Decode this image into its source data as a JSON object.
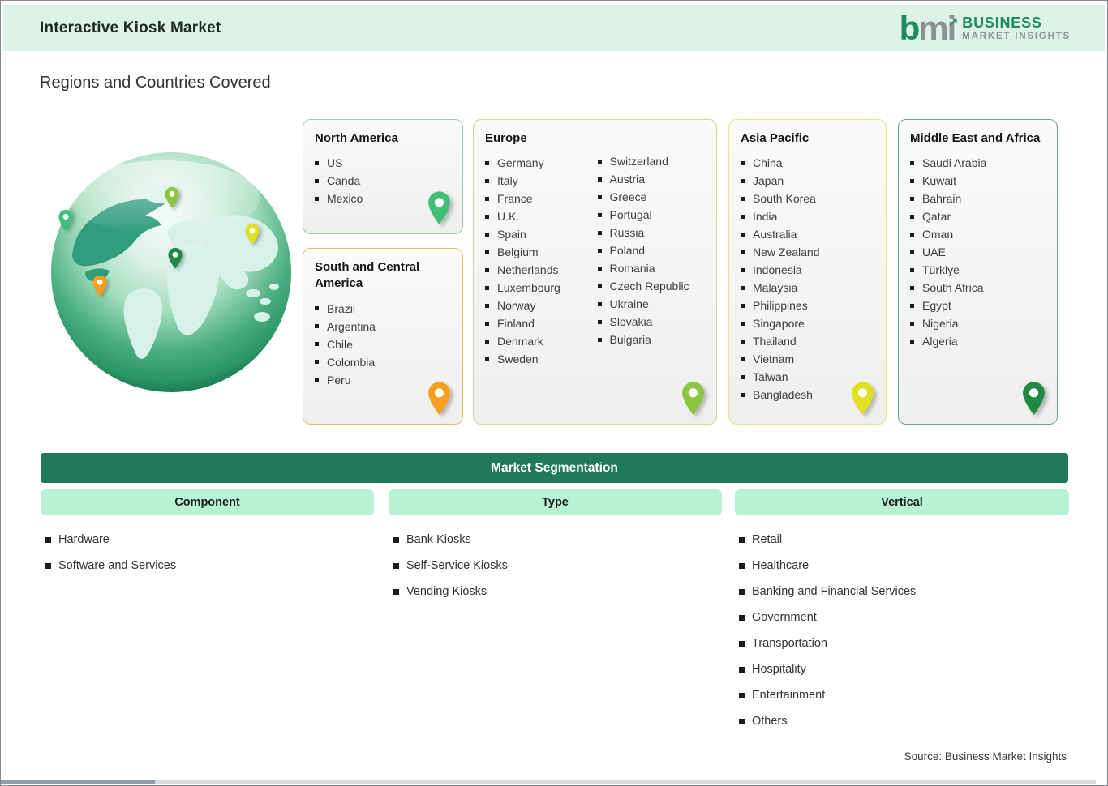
{
  "header": {
    "title": "Interactive Kiosk Market",
    "logo": {
      "mark_green": "b",
      "mark_gray": "mi",
      "arrow_glyph": "↗",
      "name_line1": "BUSINESS",
      "name_line2": "MARKET INSIGHTS"
    }
  },
  "page_title": "Regions and Countries Covered",
  "regions": [
    {
      "name": "North America",
      "countries": [
        "US",
        "Canda",
        "Mexico"
      ],
      "pin_color": "#3fbf77",
      "border_color": "#93d3ab"
    },
    {
      "name": "South and Central America",
      "countries": [
        "Brazil",
        "Argentina",
        "Chile",
        "Colombia",
        "Peru"
      ],
      "pin_color": "#f79f1f",
      "border_color": "#f2bc63"
    },
    {
      "name": "Europe",
      "countries": [
        "Germany",
        "Italy",
        "France",
        "U.K.",
        "Spain",
        "Belgium",
        "Netherlands",
        "Luxembourg",
        "Norway",
        "Finland",
        "Denmark",
        "Sweden",
        "Switzerland",
        "Austria",
        "Greece",
        "Portugal",
        "Russia",
        "Poland",
        "Romania",
        "Czech Republic",
        "Ukraine",
        "Slovakia",
        "Bulgaria"
      ],
      "pin_color": "#8cc63e",
      "border_color": "#c4dd8f"
    },
    {
      "name": "Asia Pacific",
      "countries": [
        "China",
        "Japan",
        "South Korea",
        "India",
        "Australia",
        "New Zealand",
        "Indonesia",
        "Malaysia",
        "Philippines",
        "Singapore",
        "Thailand",
        "Vietnam",
        "Taiwan",
        "Bangladesh"
      ],
      "pin_color": "#e0df20",
      "border_color": "#eae77f"
    },
    {
      "name": "Middle East and Africa",
      "countries": [
        "Saudi Arabia",
        "Kuwait",
        "Bahrain",
        "Qatar",
        "Oman",
        "UAE",
        "Türkiye",
        "South Africa",
        "Egypt",
        "Nigeria",
        "Algeria"
      ],
      "pin_color": "#1e8a44",
      "border_color": "#66a88a"
    }
  ],
  "globe": {
    "pins": [
      {
        "region": "North America",
        "color": "#3fbf77"
      },
      {
        "region": "Europe",
        "color": "#8cc63e"
      },
      {
        "region": "Asia Pacific",
        "color": "#e0df20"
      },
      {
        "region": "Middle East and Africa",
        "color": "#1e8a44"
      },
      {
        "region": "South and Central America",
        "color": "#f79f1f"
      }
    ]
  },
  "segmentation": {
    "title": "Market Segmentation",
    "columns": [
      {
        "header": "Component",
        "items": [
          "Hardware",
          "Software and Services"
        ]
      },
      {
        "header": "Type",
        "items": [
          "Bank Kiosks",
          "Self-Service Kiosks",
          "Vending Kiosks"
        ]
      },
      {
        "header": "Vertical",
        "items": [
          "Retail",
          "Healthcare",
          "Banking and Financial Services",
          "Government",
          "Transportation",
          "Hospitality",
          "Entertainment",
          "Others"
        ]
      }
    ]
  },
  "source": "Source: Business Market Insights",
  "colors": {
    "header_bg": "#ddf2e6",
    "banner_bg": "#1e7a58",
    "column_header_bg": "#b7f2d5",
    "brand_green": "#1e8a5e",
    "brand_gray": "#8a9094"
  }
}
